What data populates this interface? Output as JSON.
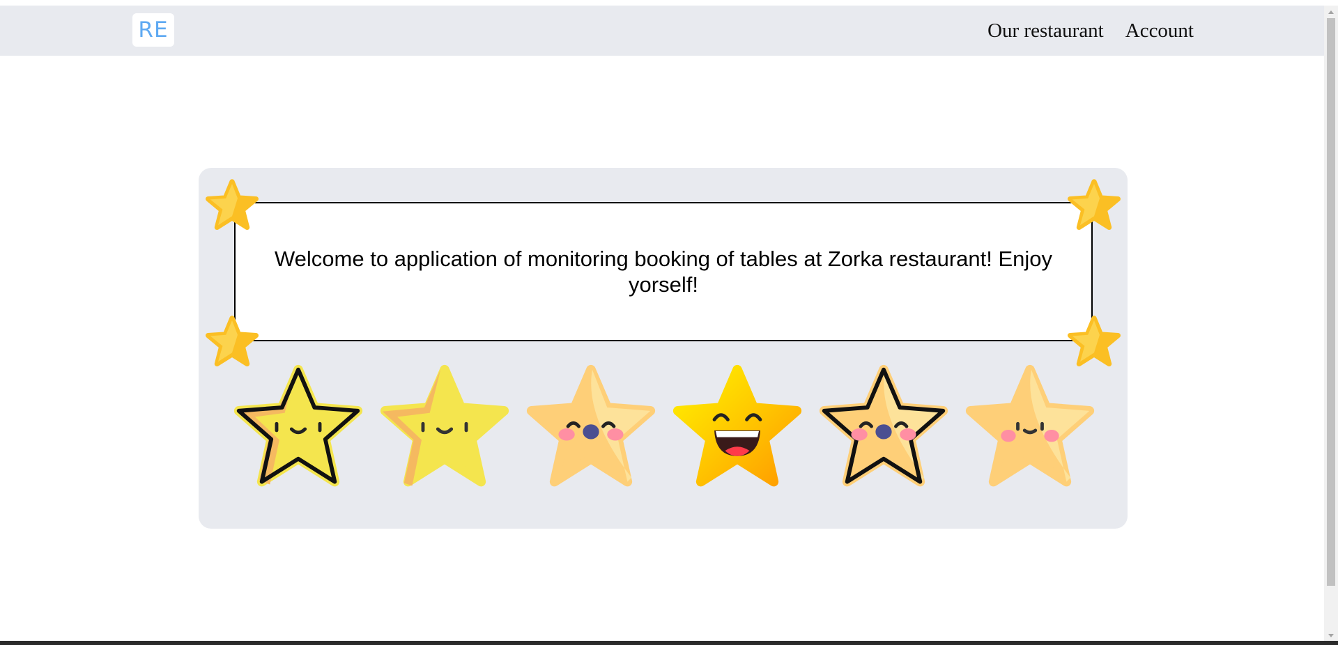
{
  "navbar": {
    "logo_text": "RE",
    "links": [
      "Our restaurant",
      "Account"
    ]
  },
  "welcome": {
    "message": "Welcome to application of monitoring booking of tables at Zorka restaurant! Enjoy yorself!"
  },
  "decorations": {
    "corner_stars": [
      "star-icon",
      "star-icon",
      "star-icon",
      "star-icon"
    ],
    "emoji_stars": [
      "smiling-star-icon",
      "smiling-star-icon",
      "blushing-star-icon",
      "laughing-star-icon",
      "blushing-star-icon",
      "sleepy-star-icon"
    ]
  },
  "colors": {
    "navbar_bg": "#e8eaef",
    "panel_bg": "#e8eaef",
    "logo_text": "#5ea9f2",
    "star_yellow": "#f4e54e",
    "star_orange": "#f5b960",
    "star_peach": "#fecf78",
    "star_gold": "#fbbf24",
    "blush_pink": "#ff8fa3"
  }
}
